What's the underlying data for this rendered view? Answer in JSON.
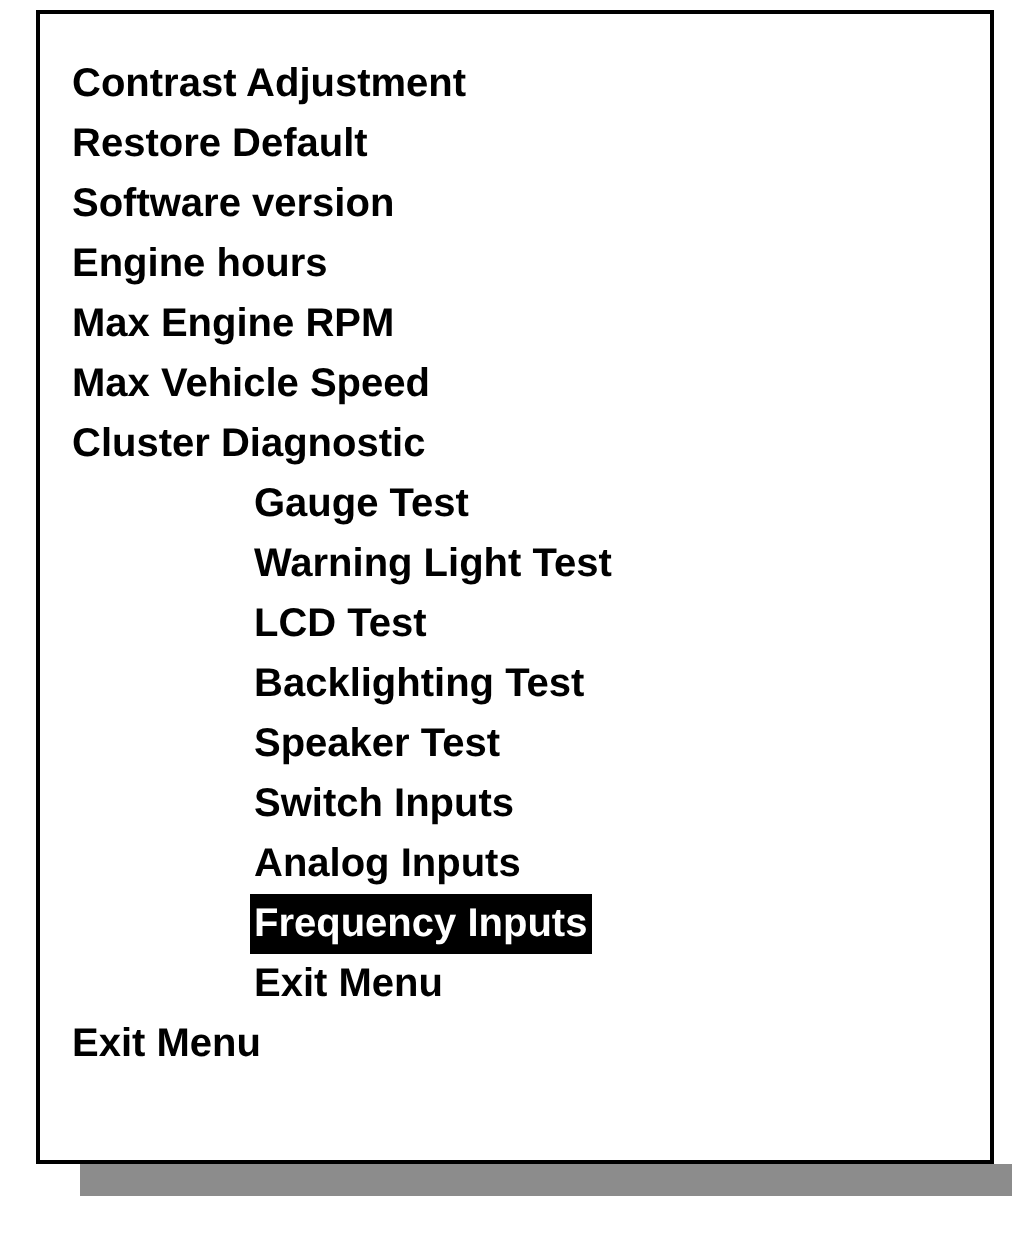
{
  "menu": [
    {
      "label": "Contrast Adjustment",
      "selected": false
    },
    {
      "label": "Restore Default",
      "selected": false
    },
    {
      "label": "Software version",
      "selected": false
    },
    {
      "label": "Engine hours",
      "selected": false
    },
    {
      "label": "Max Engine RPM",
      "selected": false
    },
    {
      "label": "Max Vehicle Speed",
      "selected": false
    },
    {
      "label": "Cluster Diagnostic",
      "selected": false,
      "children": [
        {
          "label": "Gauge Test",
          "selected": false
        },
        {
          "label": "Warning Light Test",
          "selected": false
        },
        {
          "label": "LCD Test",
          "selected": false
        },
        {
          "label": "Backlighting Test",
          "selected": false
        },
        {
          "label": "Speaker Test",
          "selected": false
        },
        {
          "label": "Switch Inputs",
          "selected": false
        },
        {
          "label": "Analog Inputs",
          "selected": false
        },
        {
          "label": "Frequency Inputs",
          "selected": true
        },
        {
          "label": "Exit Menu",
          "selected": false
        }
      ]
    },
    {
      "label": "Exit Menu",
      "selected": false
    }
  ]
}
